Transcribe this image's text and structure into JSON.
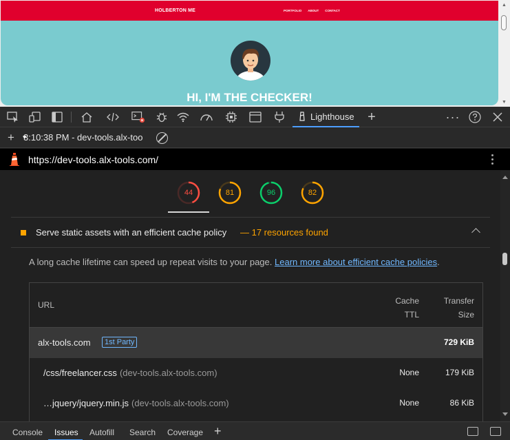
{
  "preview": {
    "brand": "HOLBERTON ME",
    "nav_links": [
      "PORTFOLIO",
      "ABOUT",
      "CONTACT"
    ],
    "hero_text": "HI, I'M THE CHECKER!"
  },
  "toolbar": {
    "icons": [
      "inspect-icon",
      "device-emulation-icon",
      "sidebar-toggle-icon",
      "welcome-icon",
      "elements-icon",
      "console-icon",
      "sources-icon",
      "network-icon",
      "performance-icon",
      "memory-icon",
      "application-icon",
      "lighthouse-icon"
    ],
    "active_tab_label": "Lighthouse",
    "colors": {
      "active_underline": "#4d9fff"
    }
  },
  "report_bar": {
    "selected_report": "3:10:38 PM - dev-tools.alx-too"
  },
  "url_bar": {
    "url": "https://dev-tools.alx-tools.com/"
  },
  "scores": [
    {
      "value": 44,
      "color": "#ff4e42",
      "fill_fraction": 0.44
    },
    {
      "value": 81,
      "color": "#ffa400",
      "fill_fraction": 0.81
    },
    {
      "value": 96,
      "color": "#0cce6b",
      "fill_fraction": 0.96
    },
    {
      "value": 82,
      "color": "#ffa400",
      "fill_fraction": 0.82
    }
  ],
  "audit": {
    "title": "Serve static assets with an efficient cache policy",
    "display_value": "— 17 resources found",
    "description": "A long cache lifetime can speed up repeat visits to your page.",
    "learn_more": "Learn more about efficient cache policies",
    "description_end": ".",
    "table": {
      "headers": {
        "url": "URL",
        "cache_ttl": [
          "Cache",
          "TTL"
        ],
        "transfer_size": [
          "Transfer",
          "Size"
        ]
      },
      "group": {
        "entity": "alx-tools.com",
        "badge": "1st Party",
        "size": "729 KiB"
      },
      "rows": [
        {
          "path": "/css/freelancer.css",
          "host": "(dev-tools.alx-tools.com)",
          "ttl": "None",
          "size": "179 KiB"
        },
        {
          "path": "…jquery/jquery.min.js",
          "host": "(dev-tools.alx-tools.com)",
          "ttl": "None",
          "size": "86 KiB"
        }
      ]
    }
  },
  "drawer": {
    "tabs": [
      "Console",
      "Issues",
      "Autofill",
      "Search",
      "Coverage"
    ],
    "active_tab": "Issues"
  }
}
